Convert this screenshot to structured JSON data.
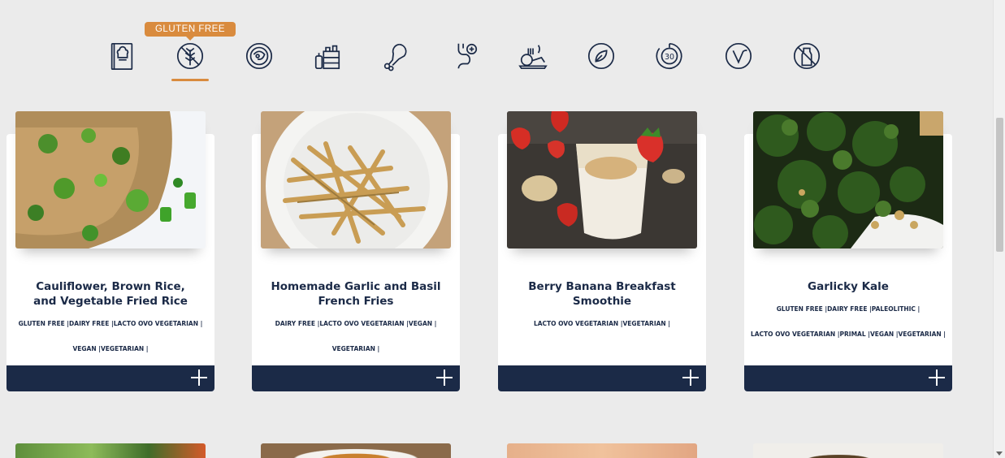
{
  "filter_bar": {
    "tooltip": "GLUTEN FREE",
    "active_index": 1,
    "icons": [
      {
        "name": "recipe-book-icon"
      },
      {
        "name": "gluten-free-icon"
      },
      {
        "name": "plate-icon"
      },
      {
        "name": "pantry-icon"
      },
      {
        "name": "chicken-leg-icon"
      },
      {
        "name": "stomach-icon"
      },
      {
        "name": "cooking-board-icon"
      },
      {
        "name": "leaf-icon"
      },
      {
        "name": "timer-30-icon"
      },
      {
        "name": "vegan-icon"
      },
      {
        "name": "no-dairy-icon"
      }
    ]
  },
  "recipes": [
    {
      "title": "Cauliflower, Brown Rice, and Vegetable Fried Rice",
      "tags_line1": "GLUTEN FREE |DAIRY FREE |LACTO OVO VEGETARIAN |",
      "tags_line2": "VEGAN |VEGETARIAN |",
      "photo": "cauliflower fried rice"
    },
    {
      "title": "Homemade Garlic and Basil French Fries",
      "tags_line1": "DAIRY FREE |LACTO OVO VEGETARIAN |VEGAN |",
      "tags_line2": "VEGETARIAN |",
      "photo": "french fries"
    },
    {
      "title": "Berry Banana Breakfast Smoothie",
      "tags_line1": "LACTO OVO VEGETARIAN |VEGETARIAN |",
      "tags_line2": "",
      "photo": "smoothie"
    },
    {
      "title": "Garlicky Kale",
      "tags_line1": "GLUTEN FREE |DAIRY FREE |PALEOLITHIC |",
      "tags_line2": "LACTO OVO VEGETARIAN |PRIMAL |VEGAN |VEGETARIAN |",
      "photo": "kale"
    }
  ],
  "colors": {
    "navy": "#1b2a47",
    "accent": "#d98b3e",
    "background": "#ebebeb"
  }
}
